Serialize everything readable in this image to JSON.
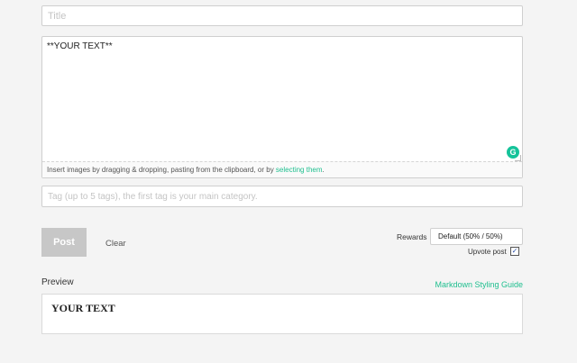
{
  "title_field": {
    "placeholder": "Title",
    "value": ""
  },
  "editor": {
    "value": "**YOUR TEXT**",
    "dropzone_text": "Insert images by dragging & dropping, pasting from the clipboard, or by ",
    "dropzone_link": "selecting them",
    "dropzone_suffix": ".",
    "grammarly_glyph": "G"
  },
  "tags_field": {
    "placeholder": "Tag (up to 5 tags), the first tag is your main category.",
    "value": ""
  },
  "actions": {
    "post_label": "Post",
    "clear_label": "Clear"
  },
  "rewards": {
    "label": "Rewards",
    "selected": "Default (50% / 50%)",
    "upvote_label": "Upvote post",
    "upvote_checked": true,
    "check_glyph": "✓"
  },
  "preview": {
    "heading": "Preview",
    "styling_link": "Markdown Styling Guide",
    "rendered_text": "YOUR TEXT"
  },
  "colors": {
    "accent": "#1fbf8f",
    "grammarly": "#15c39a",
    "post_disabled": "#c7c7c7"
  }
}
